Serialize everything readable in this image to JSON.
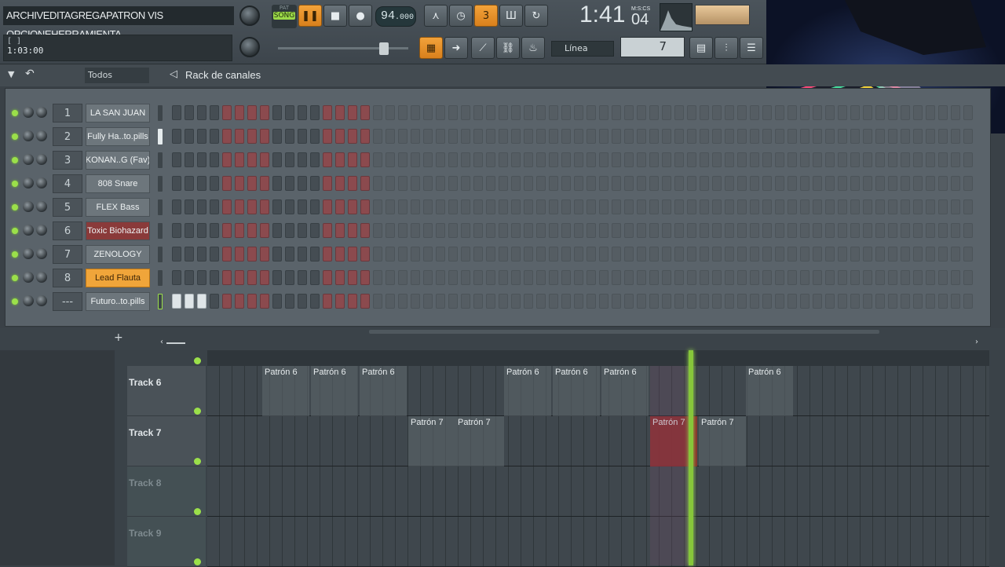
{
  "menu": {
    "items": [
      "ARCHIV",
      "EDITA",
      "GREGA",
      "PATRON",
      "VIS",
      "OPCIONE",
      "HERRAMIENTA"
    ]
  },
  "hint": {
    "line1": "[  ]",
    "line2": "1:03:00"
  },
  "transport": {
    "pat_label": "PAT",
    "song_label": "SONG",
    "tempo": "94",
    "tempo_dec": ".000",
    "time_main": "1:41",
    "time_sub": "04",
    "time_unit": "M:S:CS",
    "snap_label": "Línea",
    "pattern_number": "7"
  },
  "rack": {
    "filter": "Todos",
    "title": "Rack de canales",
    "channels": [
      {
        "num": "1",
        "name": "LA SAN JUAN"
      },
      {
        "num": "2",
        "name": "Fully Ha..to.pills"
      },
      {
        "num": "3",
        "name": "KONAN..G (Fav)"
      },
      {
        "num": "4",
        "name": "808 Snare"
      },
      {
        "num": "5",
        "name": "FLEX Bass"
      },
      {
        "num": "6",
        "name": "Toxic Biohazard"
      },
      {
        "num": "7",
        "name": "ZENOLOGY"
      },
      {
        "num": "8",
        "name": "Lead Flauta"
      },
      {
        "num": "---",
        "name": "Futuro..to.pills"
      }
    ]
  },
  "playlist": {
    "tracks": [
      "Track 6",
      "Track 7",
      "Track 8",
      "Track 9"
    ],
    "clip6": "Patrón 6",
    "clip7": "Patrón 7"
  },
  "add_label": "+"
}
